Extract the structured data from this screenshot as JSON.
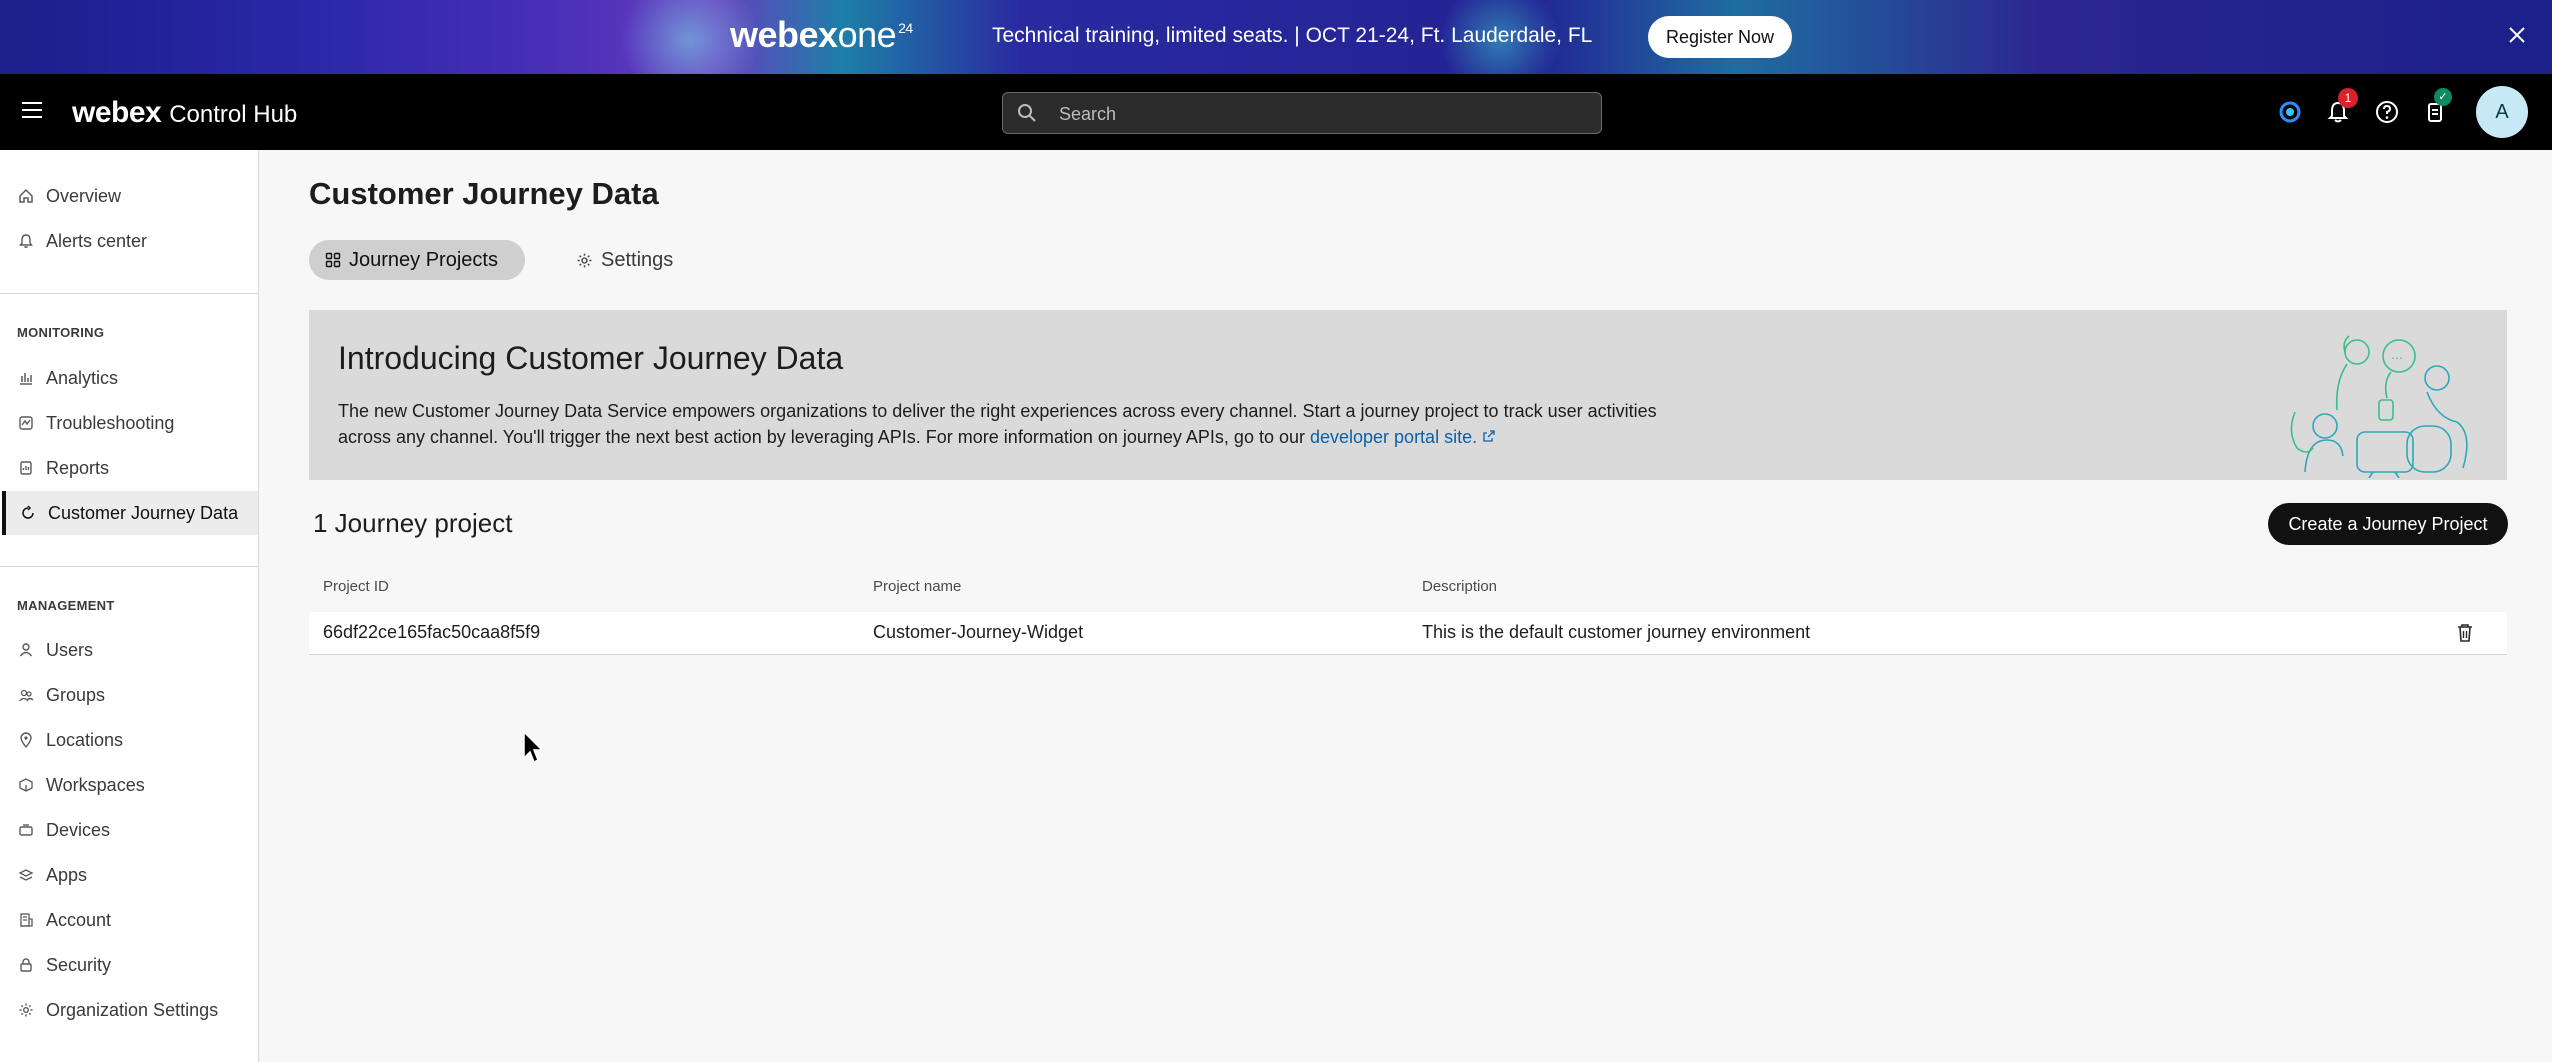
{
  "banner": {
    "brand_webex": "webex",
    "brand_one": "one",
    "brand_superscript": "24",
    "message": "Technical training, limited seats. | OCT 21-24, Ft. Lauderdale, FL",
    "register_label": "Register Now",
    "close_icon": "close-icon"
  },
  "header": {
    "brand": "webex",
    "product": "Control Hub",
    "search_placeholder": "Search",
    "notification_count": "1",
    "avatar_initial": "A"
  },
  "sidebar": {
    "top_items": [
      {
        "label": "Overview",
        "icon": "home-icon"
      },
      {
        "label": "Alerts center",
        "icon": "bell-icon"
      }
    ],
    "monitoring_heading": "MONITORING",
    "monitoring_items": [
      {
        "label": "Analytics",
        "icon": "analytics-icon"
      },
      {
        "label": "Troubleshooting",
        "icon": "troubleshooting-icon"
      },
      {
        "label": "Reports",
        "icon": "reports-icon"
      },
      {
        "label": "Customer Journey Data",
        "icon": "journey-icon",
        "active": true
      }
    ],
    "management_heading": "MANAGEMENT",
    "management_items": [
      {
        "label": "Users",
        "icon": "user-icon"
      },
      {
        "label": "Groups",
        "icon": "groups-icon"
      },
      {
        "label": "Locations",
        "icon": "location-icon"
      },
      {
        "label": "Workspaces",
        "icon": "workspace-icon"
      },
      {
        "label": "Devices",
        "icon": "devices-icon"
      },
      {
        "label": "Apps",
        "icon": "apps-icon"
      },
      {
        "label": "Account",
        "icon": "account-icon"
      },
      {
        "label": "Security",
        "icon": "lock-icon"
      },
      {
        "label": "Organization Settings",
        "icon": "gear-icon"
      }
    ]
  },
  "main": {
    "title": "Customer Journey Data",
    "tabs": [
      {
        "label": "Journey Projects",
        "icon": "grid-icon",
        "active": true
      },
      {
        "label": "Settings",
        "icon": "gear-icon"
      }
    ],
    "intro": {
      "heading": "Introducing Customer Journey Data",
      "body": "The new Customer Journey Data Service empowers organizations to deliver the right experiences across every channel. Start a journey project to track user activities across any channel. You'll trigger the next best action by leveraging APIs. For more information on journey APIs, go to our ",
      "link_text": "developer portal site."
    },
    "project_count": "1 Journey project",
    "create_button": "Create a Journey Project",
    "table": {
      "headers": [
        "Project ID",
        "Project name",
        "Description"
      ],
      "rows": [
        {
          "id": "66df22ce165fac50caa8f5f9",
          "name": "Customer-Journey-Widget",
          "description": "This is the default customer journey environment"
        }
      ]
    }
  },
  "colors": {
    "banner_bg": "#232394",
    "header_bg": "#000000",
    "link": "#0d5fa6",
    "badge": "#d6232c",
    "avatar_bg": "#c7e8f5"
  }
}
